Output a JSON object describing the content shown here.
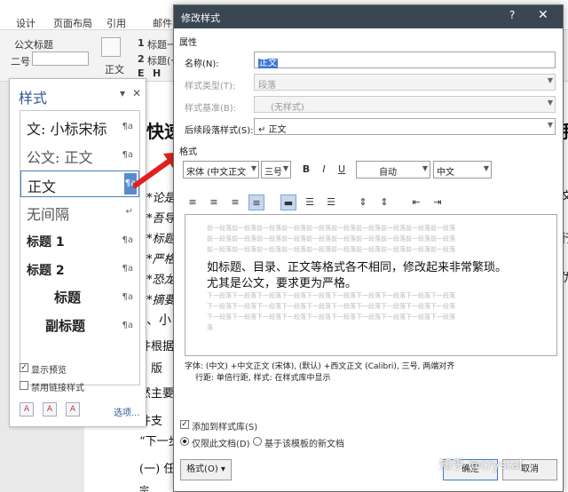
{
  "ribbon": {
    "tabs": [
      "设计",
      "页面布局",
      "引用",
      "邮件"
    ],
    "style_gallery": [
      "公文标题",
      "标题一",
      "标题(一"
    ],
    "font_size": "二号",
    "large_btn": "正文",
    "nums": [
      "1",
      "2",
      "E",
      "H"
    ]
  },
  "document": {
    "fragments": [
      "快速",
      "手",
      "*论是",
      "*吾导",
      "*标题",
      "*严格",
      "*恐龙",
      "*摘要",
      "、小",
      "件根据",
      "、版",
      "然主要",
      "件支",
      "“下一步",
      "(一) 任",
      "宗",
      "文",
      "行",
      "优"
    ]
  },
  "styles_pane": {
    "title": "样式",
    "items": [
      {
        "name": "文: 小标宋标",
        "mark": "¶a"
      },
      {
        "name": "公文: 正文",
        "mark": "¶a"
      },
      {
        "name": "正文",
        "mark": "¶a"
      },
      {
        "name": "无间隔",
        "mark": "↵"
      },
      {
        "name": "标题 1",
        "mark": "¶a"
      },
      {
        "name": "标题 2",
        "mark": "¶a"
      },
      {
        "name": "标题",
        "mark": "¶a"
      },
      {
        "name": "副标题",
        "mark": "¶a"
      }
    ],
    "show_preview": "显示预览",
    "disable_linked": "禁用链接样式",
    "options": "选项..."
  },
  "dialog": {
    "title": "修改样式",
    "help": "?",
    "close": "✕",
    "properties_label": "属性",
    "name_label": "名称(N):",
    "name_value": "正文",
    "type_label": "样式类型(T):",
    "type_value": "段落",
    "based_label": "样式基准(B):",
    "based_value": "(无样式)",
    "next_label": "后续段落样式(S):",
    "next_value": "↵ 正文",
    "format_label": "格式",
    "font_value": "宋体 (中文正文",
    "size_value": "三号",
    "bold": "B",
    "italic": "I",
    "underline": "U",
    "color_value": "自动",
    "lang_value": "中文",
    "preview_prev": "前一段落前一段落前一段落前一段落前一段落前一段落前一段落前一段落前一段落前一段落",
    "preview_main_1": "如标题、目录、正文等格式各不相同，修改起来非常繁琐。",
    "preview_main_2": "尤其是公文，要求更为严格。",
    "preview_next": "下一段落下一段落下一段落下一段落下一段落下一段落下一段落下一段落下一段落下一段落",
    "preview_next_last": "落",
    "desc_line1": "字体: (中文) +中文正文 (宋体), (默认) +西文正文 (Calibri), 三号, 两端对齐",
    "desc_line2": "行距: 单倍行距, 样式: 在样式库中显示",
    "add_to_gallery": "添加到样式库(S)",
    "only_this_doc": "仅限此文档(D)",
    "new_docs": "基于该模板的新文档",
    "format_button": "格式(O) ▾",
    "ok_button": "确定",
    "cancel_button": "取消"
  },
  "watermark": "知乎 @crystal"
}
